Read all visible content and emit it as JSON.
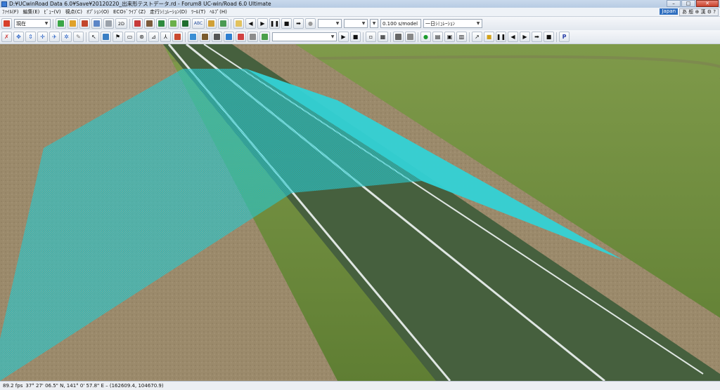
{
  "window": {
    "title": "D:¥UCwinRoad Data 6.0¥Save¥20120220_出来形テストデータ.rd - Forum8 UC-win/Road 6.0 Ultimate",
    "minimize": "–",
    "maximize": "□",
    "close": "✕"
  },
  "menu": {
    "items": [
      "ﾌｧｲﾙ(F)",
      "編集(E)",
      "ﾋﾞｭｰ(V)",
      "視点(C)",
      "ｵﾌﾟｼｮﾝ(O)",
      "ECOﾄﾞﾗｲﾌﾞ(Z)",
      "走行ｼﾐｭﾚｰｼｮﾝ(D)",
      "ﾂｰﾙ(T)",
      "ﾍﾙﾌﾟ(H)"
    ],
    "lang": "Japan",
    "ime": "あ 般 ⊕ 漢 ⚙ ?"
  },
  "toolbar1": {
    "view_combo": "現在",
    "twod_label": "2D",
    "abc_label": "ABC",
    "speed_value": "0.100 s/model",
    "mode_combo": "一日ｼﾐｭﾚｰｼｮﾝ",
    "icons": [
      "view-mode-icon",
      "terrain-icon",
      "road-icon",
      "intersection-icon",
      "model-icon",
      "object-icon",
      "2d-view-icon",
      "car-icon",
      "texture-icon",
      "tree-icon",
      "landscape-icon",
      "abc-text-icon",
      "image-icon",
      "script-icon",
      "rewind-icon",
      "play-icon",
      "pause-icon",
      "stop-icon",
      "step-icon",
      "record-icon"
    ]
  },
  "toolbar2": {
    "icons": [
      "rotate-icon",
      "move-icon",
      "up-down-icon",
      "zoom-icon",
      "fly-icon",
      "walk-icon",
      "select-icon",
      "layer-icon",
      "pointer-icon",
      "measure-icon",
      "steering-icon",
      "drive-icon",
      "pedestrian-icon",
      "paint-icon",
      "film-icon",
      "camera-icon",
      "traffic-icon",
      "vehicle-icon",
      "signal-icon",
      "building-icon",
      "play-icon",
      "stop-icon",
      "screenshot-icon",
      "export-icon",
      "panel-icon",
      "green-light-icon",
      "table-icon",
      "monitor-icon",
      "display-icon",
      "cursor-icon",
      "note-icon",
      "pause-icon",
      "back-icon",
      "forward-icon",
      "next-icon",
      "end-icon",
      "help-icon"
    ]
  },
  "status": {
    "fps": "89.2 fps",
    "coords": "37° 27' 06.5\" N, 141° 0' 57.8\" E  –  (162609.4, 104670.9)"
  },
  "colors": {
    "grass": "#6d8d3c",
    "dirt": "#9b8a6b",
    "road": "#46603e",
    "mesh": "#33d2d6",
    "line": "#dfe6e2"
  }
}
